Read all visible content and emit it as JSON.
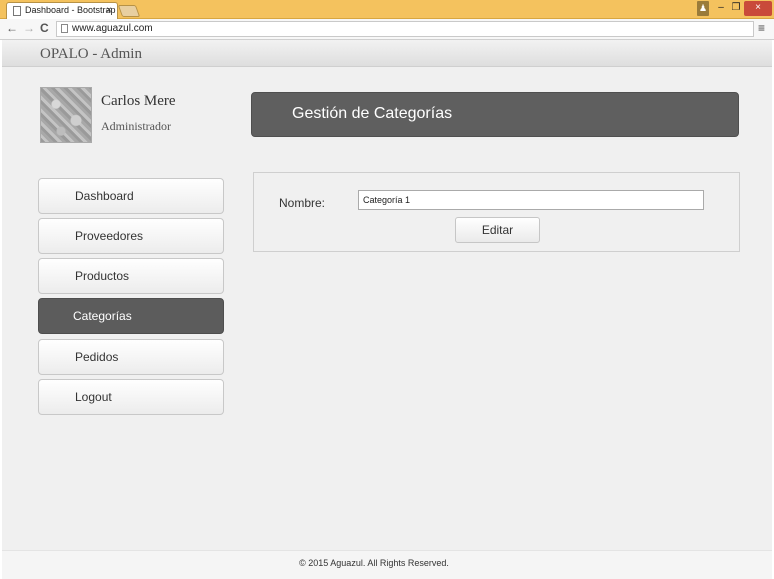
{
  "browser": {
    "tab_title": "Dashboard - Bootstrap Ac",
    "tab_close": "×",
    "url": "www.aguazul.com",
    "nav_back": "←",
    "nav_forward": "→",
    "nav_reload": "C",
    "menu": "≡",
    "win_user": "♟",
    "win_min": "–",
    "win_max": "❐",
    "win_close": "×"
  },
  "app": {
    "brand": "OPALO - Admin",
    "profile": {
      "name": "Carlos Mere",
      "role": "Administrador"
    },
    "sidebar": {
      "items": [
        {
          "label": "Dashboard"
        },
        {
          "label": "Proveedores"
        },
        {
          "label": "Productos"
        },
        {
          "label": "Categorías"
        },
        {
          "label": "Pedidos"
        },
        {
          "label": "Logout"
        }
      ],
      "active_index": 3
    },
    "header": {
      "title": "Gestión de Categorías"
    },
    "form": {
      "name_label": "Nombre:",
      "name_value": "Categoría 1",
      "edit_label": "Editar"
    },
    "footer": {
      "text": "© 2015 Aguazul. All Rights Reserved."
    }
  },
  "colors": {
    "header_bg": "#5f5f5f",
    "active_item_bg": "#5c5c5c",
    "titlebar": "#f4c25e"
  }
}
